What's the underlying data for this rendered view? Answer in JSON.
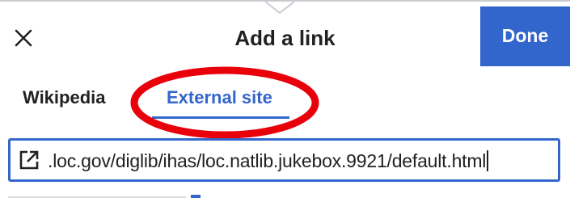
{
  "dialog": {
    "title": "Add a link",
    "close_icon": "close-icon",
    "done_label": "Done"
  },
  "tabs": [
    {
      "label": "Wikipedia",
      "active": false
    },
    {
      "label": "External site",
      "active": true
    }
  ],
  "url_field": {
    "icon": "external-link-icon",
    "value": ".loc.gov/diglib/ihas/loc.natlib.jukebox.9921/default.html"
  },
  "colors": {
    "accent": "#3366cc",
    "annotation": "#e8000b",
    "text": "#202122",
    "border": "#c8ccd1"
  }
}
